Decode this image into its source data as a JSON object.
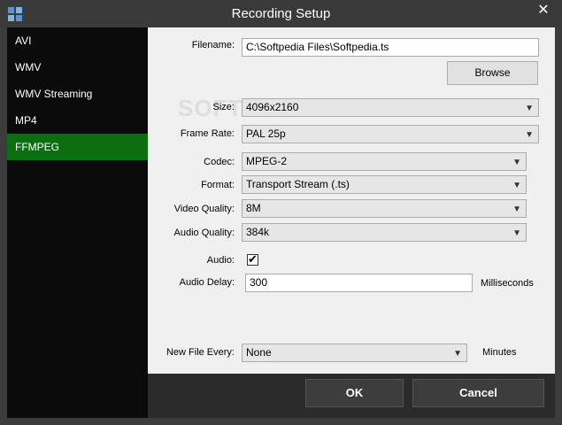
{
  "window": {
    "title": "Recording Setup",
    "close_glyph": "✕"
  },
  "sidebar": {
    "items": [
      {
        "label": "AVI"
      },
      {
        "label": "WMV"
      },
      {
        "label": "WMV Streaming"
      },
      {
        "label": "MP4"
      },
      {
        "label": "FFMPEG",
        "active": true
      }
    ]
  },
  "form": {
    "filename_label": "Filename:",
    "filename_value": "C:\\Softpedia Files\\Softpedia.ts",
    "browse_label": "Browse",
    "size_label": "Size:",
    "size_value": "4096x2160",
    "framerate_label": "Frame Rate:",
    "framerate_value": "PAL 25p",
    "codec_label": "Codec:",
    "codec_value": "MPEG-2",
    "format_label": "Format:",
    "format_value": "Transport Stream (.ts)",
    "videoquality_label": "Video Quality:",
    "videoquality_value": "8M",
    "audioquality_label": "Audio Quality:",
    "audioquality_value": "384k",
    "audio_label": "Audio:",
    "audio_checked": true,
    "audiodelay_label": "Audio Delay:",
    "audiodelay_value": "300",
    "audiodelay_unit": "Milliseconds",
    "newfile_label": "New File Every:",
    "newfile_value": "None",
    "newfile_unit": "Minutes"
  },
  "watermark": "SOFTPEDIA",
  "footer": {
    "ok_label": "OK",
    "cancel_label": "Cancel"
  },
  "colors": {
    "accent": "#0c6e10",
    "sidebar_bg": "#0b0b0b",
    "content_bg": "#f0f0f0"
  }
}
